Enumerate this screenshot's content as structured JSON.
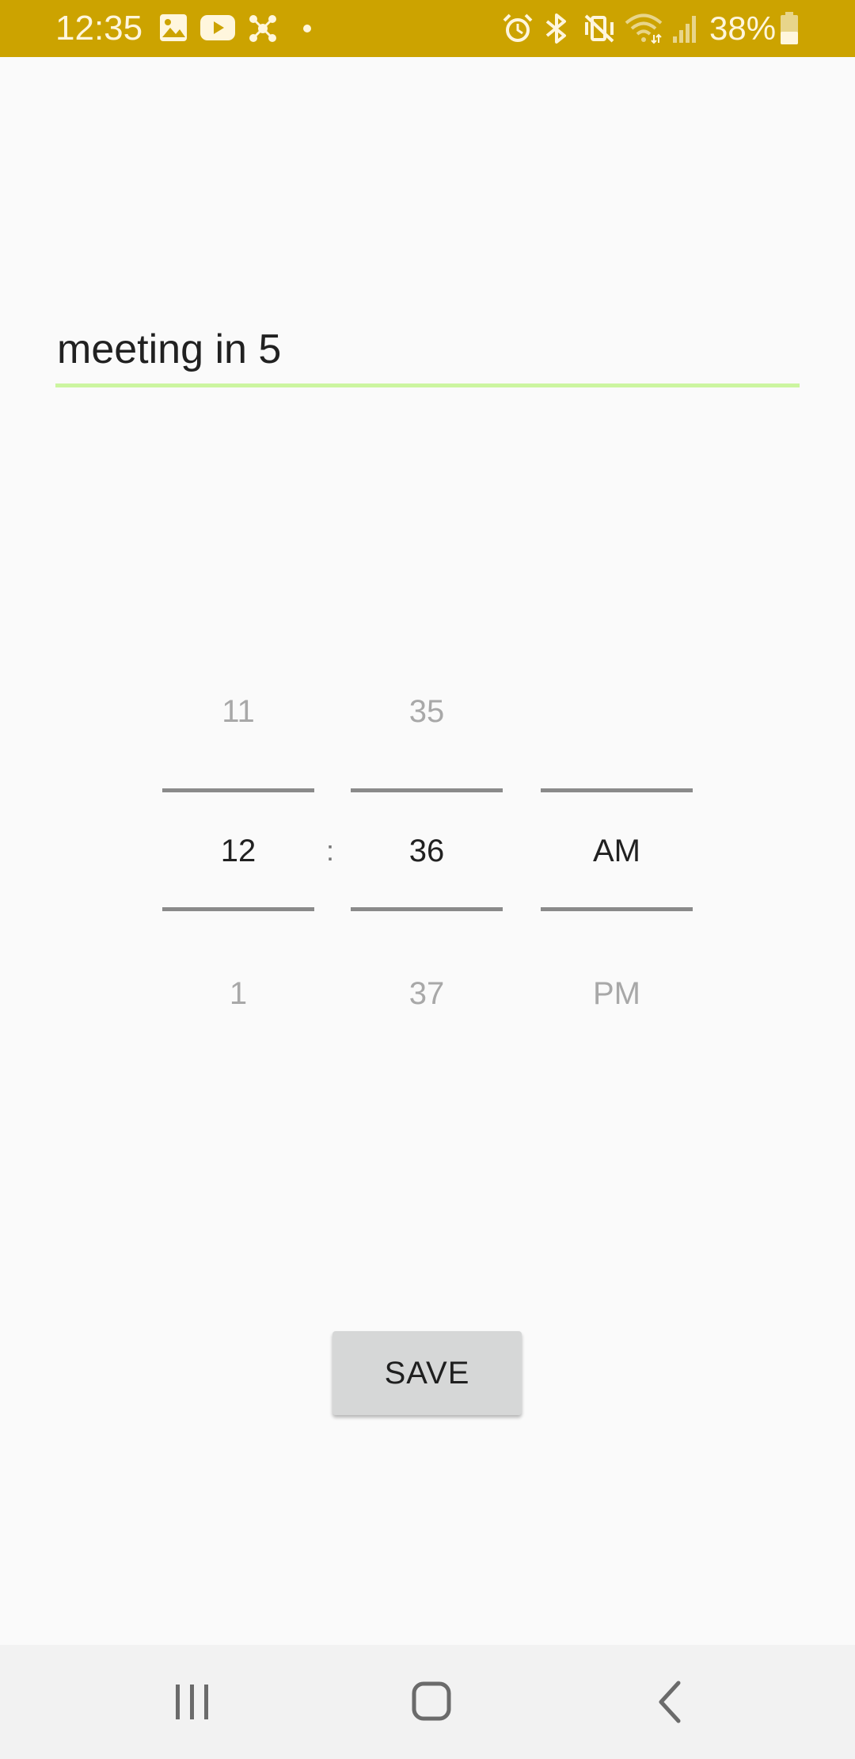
{
  "status_bar": {
    "time": "12:35",
    "battery": "38%",
    "background": "#cca300",
    "icons": [
      "gallery-icon",
      "youtube-icon",
      "app-notification-icon",
      "dot-icon",
      "alarm-icon",
      "bluetooth-icon",
      "mute-vibrate-icon",
      "wifi-icon",
      "signal-icon",
      "battery-icon"
    ]
  },
  "reminder": {
    "text": "meeting in 5",
    "underline_color": "#ccf5a0"
  },
  "time_picker": {
    "hour": {
      "prev": "11",
      "current": "12",
      "next": "1"
    },
    "separator": ":",
    "minute": {
      "prev": "35",
      "current": "36",
      "next": "37"
    },
    "ampm": {
      "prev": "",
      "current": "AM",
      "next": "PM"
    }
  },
  "save_button": {
    "label": "SAVE"
  },
  "nav_bar": {
    "icons": [
      "recent-apps-icon",
      "home-icon",
      "back-icon"
    ]
  }
}
